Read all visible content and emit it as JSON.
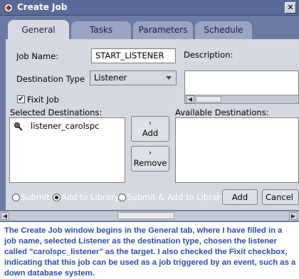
{
  "window": {
    "title": "Create Job"
  },
  "tabs": [
    {
      "label": "General",
      "active": true
    },
    {
      "label": "Tasks",
      "active": false
    },
    {
      "label": "Parameters",
      "active": false
    },
    {
      "label": "Schedule",
      "active": false
    }
  ],
  "form": {
    "job_name_label": "Job Name:",
    "job_name_value": "START_LISTENER",
    "description_label": "Description:",
    "destination_type_label": "Destination Type",
    "destination_type_value": "Listener",
    "fixit_label": "Fixit Job",
    "fixit_checked": true,
    "selected_destinations_label": "Selected Destinations:",
    "available_destinations_label": "Available Destinations:",
    "selected_destinations": [
      "listener_carolspc"
    ]
  },
  "buttons": {
    "add_label": "Add",
    "remove_label": "Remove",
    "bottom_add_label": "Add",
    "cancel_label": "Cancel"
  },
  "submit_options": [
    {
      "label": "Submit",
      "selected": false
    },
    {
      "label": "Add to Library",
      "selected": true
    },
    {
      "label": "Submit & Add to Library",
      "selected": false
    }
  ],
  "caption": "The Create Job window begins in the General tab, where I have filled in a job name, selected Listener as the destination type, chosen the listener called \"carolspc_listener\" as the target. I also checked the Fixit checkbox, indicating that this job can be used as a job triggered by an event, such as a down database system.",
  "colors": {
    "window_bg": "#6b7aa3",
    "panel_bg": "#d4d8e1",
    "caption_text": "#2a4fa8"
  }
}
